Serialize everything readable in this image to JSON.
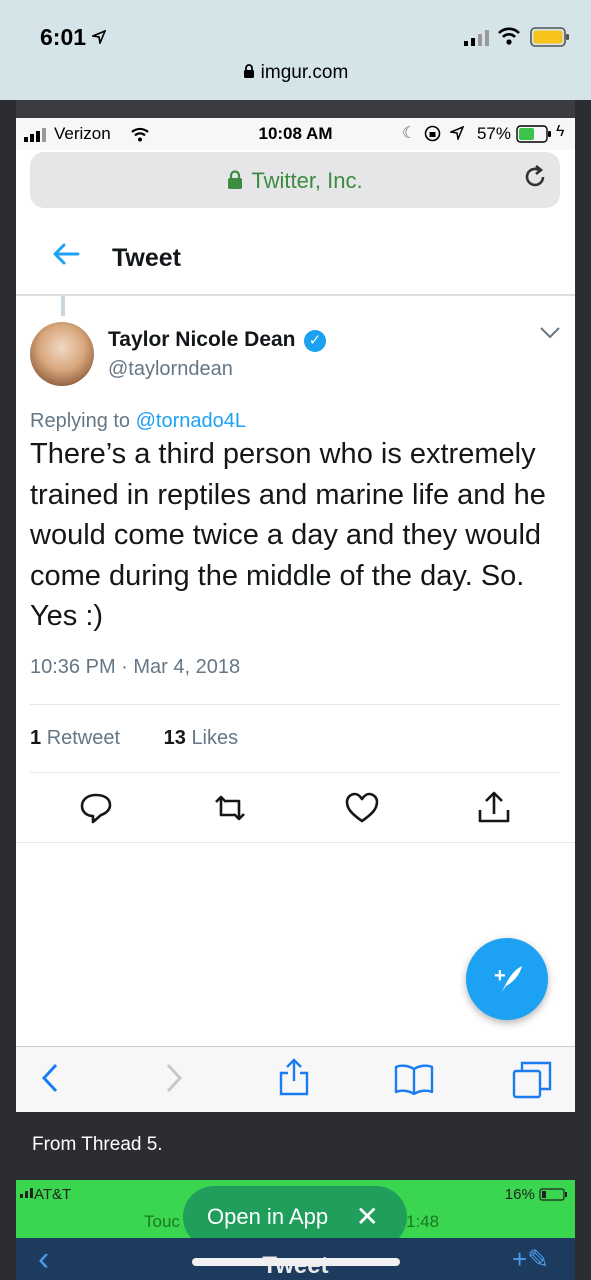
{
  "outer_status": {
    "time": "6:01",
    "url": "imgur.com"
  },
  "inner_status": {
    "carrier": "Verizon",
    "time": "10:08 AM",
    "battery": "57%"
  },
  "browser": {
    "url": "Twitter, Inc."
  },
  "header": {
    "title": "Tweet"
  },
  "tweet": {
    "name": "Taylor Nicole Dean",
    "handle": "@taylorndean",
    "replying_prefix": "Replying to ",
    "replying_to": "@tornado4L",
    "text": "There’s a third person who is extremely trained in reptiles and marine life and he would come twice a day and they would come during the middle of the day. So. Yes :)",
    "timestamp": "10:36 PM · Mar 4, 2018",
    "retweets_count": "1",
    "retweets_label": "Retweet",
    "likes_count": "13",
    "likes_label": "Likes"
  },
  "caption": "From Thread 5.",
  "overlay": {
    "carrier": "AT&T",
    "battery": "16%",
    "partial_left": "Touc",
    "partial_time": "1:48",
    "open_label": "Open in App",
    "close_glyph": "✕"
  },
  "underlay": {
    "title": "Tweet"
  },
  "icons": {
    "reply": "reply-icon",
    "retweet": "retweet-icon",
    "like": "heart-icon",
    "share": "share-icon",
    "compose": "compose-icon",
    "back": "back-arrow-icon",
    "menu": "chevron-down-icon",
    "verified": "verified-badge-icon",
    "lock": "lock-icon",
    "reload": "reload-icon"
  },
  "colors": {
    "twitter_blue": "#1da1f2",
    "overlay_green": "#3bd64f",
    "lock_green": "#3c8c40"
  }
}
